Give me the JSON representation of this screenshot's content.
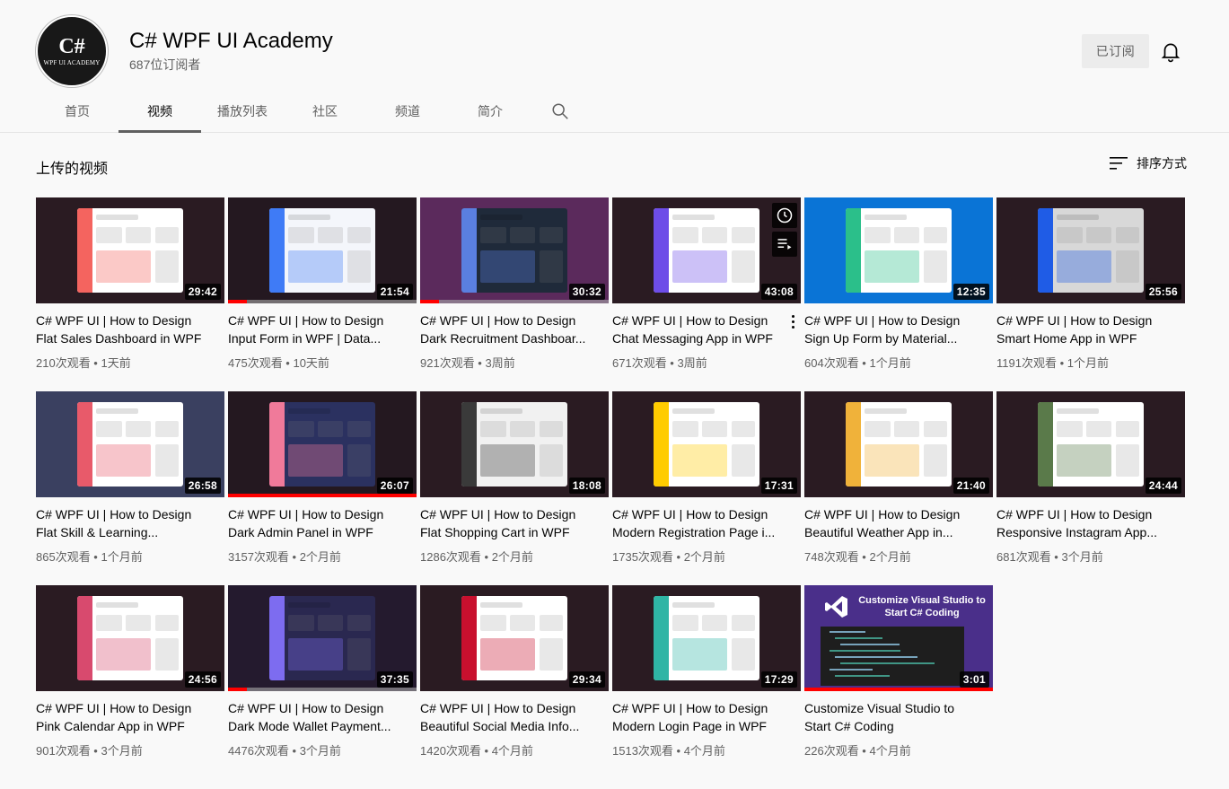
{
  "channel": {
    "avatar_mark": "C#",
    "avatar_sub": "WPF UI ACADEMY",
    "name": "C# WPF UI Academy",
    "subscribers": "687位订阅者",
    "subscribed_label": "已订阅"
  },
  "tabs": [
    {
      "label": "首页"
    },
    {
      "label": "视频",
      "active": true
    },
    {
      "label": "播放列表"
    },
    {
      "label": "社区"
    },
    {
      "label": "频道"
    },
    {
      "label": "简介"
    }
  ],
  "section": {
    "title": "上传的视频",
    "sort_label": "排序方式"
  },
  "videos": [
    {
      "title": "C# WPF UI | How to Design Flat Sales Dashboard in WPF",
      "meta": "210次观看 • 1天前",
      "duration": "29:42",
      "progress": 0,
      "theme": {
        "bg": "#2a1b22",
        "panel": "#ffffff",
        "accent": "#f4645f"
      }
    },
    {
      "title": "C# WPF UI | How to Design Input Form in WPF | Data...",
      "meta": "475次观看 • 10天前",
      "duration": "21:54",
      "progress": 0.1,
      "theme": {
        "bg": "#241820",
        "panel": "#f4f6fb",
        "accent": "#3f7bf6"
      }
    },
    {
      "title": "C# WPF UI | How to Design Dark Recruitment Dashboar...",
      "meta": "921次观看 • 3周前",
      "duration": "30:32",
      "progress": 0.1,
      "theme": {
        "bg": "#5b2a5c",
        "panel": "#1f2a3a",
        "accent": "#5a7fe0"
      }
    },
    {
      "title": "C# WPF UI | How to Design Chat Messaging App in WPF",
      "meta": "671次观看 • 3周前",
      "duration": "43:08",
      "progress": 0,
      "theme": {
        "bg": "#2a1b22",
        "panel": "#ffffff",
        "accent": "#6d4de8"
      }
    },
    {
      "title": "C# WPF UI | How to Design Sign Up Form by Material...",
      "meta": "604次观看 • 1个月前",
      "duration": "12:35",
      "progress": 0,
      "theme": {
        "bg": "#0a74d6",
        "panel": "#ffffff",
        "accent": "#2bbf8a"
      }
    },
    {
      "title": "C# WPF UI | How to Design Smart Home App in WPF",
      "meta": "1191次观看 • 1个月前",
      "duration": "25:56",
      "progress": 0,
      "theme": {
        "bg": "#2a1b22",
        "panel": "#d8d8d8",
        "accent": "#1f5ce6"
      }
    },
    {
      "title": "C# WPF UI | How to Design Flat Skill & Learning...",
      "meta": "865次观看 • 1个月前",
      "duration": "26:58",
      "progress": 0,
      "theme": {
        "bg": "#3a4060",
        "panel": "#ffffff",
        "accent": "#e85a6a"
      }
    },
    {
      "title": "C# WPF UI | How to Design Dark Admin Panel in WPF",
      "meta": "3157次观看 • 2个月前",
      "duration": "26:07",
      "progress": 1,
      "theme": {
        "bg": "#241820",
        "panel": "#2b3160",
        "accent": "#f07a9a"
      }
    },
    {
      "title": "C# WPF UI | How to Design Flat Shopping Cart in WPF",
      "meta": "1286次观看 • 2个月前",
      "duration": "18:08",
      "progress": 0,
      "theme": {
        "bg": "#2a1b22",
        "panel": "#f1f1f1",
        "accent": "#3a3a3a"
      }
    },
    {
      "title": "C# WPF UI | How to Design Modern Registration Page i...",
      "meta": "1735次观看 • 2个月前",
      "duration": "17:31",
      "progress": 0,
      "theme": {
        "bg": "#2a1b22",
        "panel": "#ffffff",
        "accent": "#ffcc00"
      }
    },
    {
      "title": "C# WPF UI | How to Design Beautiful Weather App in...",
      "meta": "748次观看 • 2个月前",
      "duration": "21:40",
      "progress": 0,
      "theme": {
        "bg": "#2a1b22",
        "panel": "#ffffff",
        "accent": "#f0b23a"
      }
    },
    {
      "title": "C# WPF UI | How to Design Responsive Instagram App...",
      "meta": "681次观看 • 3个月前",
      "duration": "24:44",
      "progress": 0,
      "theme": {
        "bg": "#2a1b22",
        "panel": "#ffffff",
        "accent": "#5a7a4a"
      }
    },
    {
      "title": "C# WPF UI | How to Design Pink Calendar App in WPF",
      "meta": "901次观看 • 3个月前",
      "duration": "24:56",
      "progress": 0,
      "theme": {
        "bg": "#2a1b22",
        "panel": "#ffffff",
        "accent": "#d84a6e"
      }
    },
    {
      "title": "C# WPF UI | How to Design Dark Mode Wallet Payment...",
      "meta": "4476次观看 • 3个月前",
      "duration": "37:35",
      "progress": 0.1,
      "theme": {
        "bg": "#241a2e",
        "panel": "#2a2850",
        "accent": "#7d6cf0"
      }
    },
    {
      "title": "C# WPF UI | How to Design Beautiful Social Media Info...",
      "meta": "1420次观看 • 4个月前",
      "duration": "29:34",
      "progress": 0,
      "theme": {
        "bg": "#2a1b22",
        "panel": "#ffffff",
        "accent": "#c8102e"
      }
    },
    {
      "title": "C# WPF UI | How to Design Modern Login Page in WPF",
      "meta": "1513次观看 • 4个月前",
      "duration": "17:29",
      "progress": 0,
      "theme": {
        "bg": "#2a1b22",
        "panel": "#ffffff",
        "accent": "#2fb5a5"
      }
    },
    {
      "title": "Customize Visual Studio to Start C# Coding",
      "meta": "226次观看 • 4个月前",
      "duration": "3:01",
      "progress": 1,
      "theme": {
        "bg": "#4a2f8a",
        "panel": "#1e1e1e",
        "accent": "#ffffff"
      },
      "overlay_text": "Customize Visual Studio to Start C# Coding"
    }
  ],
  "hover_card_index": 3,
  "icons": {
    "search": "search-icon",
    "bell": "bell-icon",
    "sort": "sort-icon",
    "watch_later": "clock-icon",
    "add_to_queue": "queue-icon",
    "more": "more-vert-icon"
  }
}
